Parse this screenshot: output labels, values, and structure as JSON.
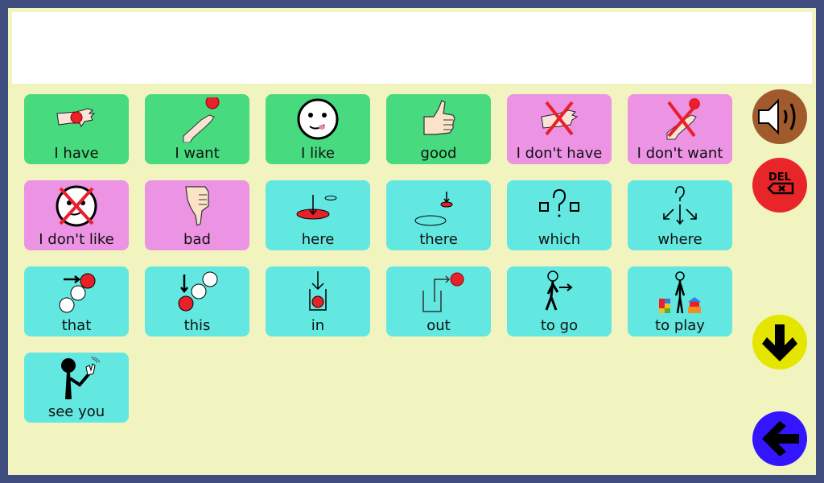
{
  "message_bar": {
    "text": ""
  },
  "tiles": [
    {
      "label": "I have",
      "category": "green",
      "icon": "hand-holding-ball-icon"
    },
    {
      "label": "I want",
      "category": "green",
      "icon": "hand-reaching-ball-icon"
    },
    {
      "label": "I like",
      "category": "green",
      "icon": "smiley-face-icon"
    },
    {
      "label": "good",
      "category": "green",
      "icon": "thumbs-up-icon"
    },
    {
      "label": "I don't have",
      "category": "pink",
      "icon": "crossed-hand-holding-icon"
    },
    {
      "label": "I don't want",
      "category": "pink",
      "icon": "crossed-hand-reaching-icon"
    },
    {
      "label": "I don't like",
      "category": "pink",
      "icon": "crossed-smiley-icon"
    },
    {
      "label": "bad",
      "category": "pink",
      "icon": "thumbs-down-icon"
    },
    {
      "label": "here",
      "category": "cyan",
      "icon": "here-icon"
    },
    {
      "label": "there",
      "category": "cyan",
      "icon": "there-icon"
    },
    {
      "label": "which",
      "category": "cyan",
      "icon": "which-icon"
    },
    {
      "label": "where",
      "category": "cyan",
      "icon": "where-icon"
    },
    {
      "label": "that",
      "category": "cyan",
      "icon": "that-icon"
    },
    {
      "label": "this",
      "category": "cyan",
      "icon": "this-icon"
    },
    {
      "label": "in",
      "category": "cyan",
      "icon": "in-icon"
    },
    {
      "label": "out",
      "category": "cyan",
      "icon": "out-icon"
    },
    {
      "label": "to go",
      "category": "cyan",
      "icon": "walking-person-icon"
    },
    {
      "label": "to play",
      "category": "cyan",
      "icon": "person-with-toys-icon"
    },
    {
      "label": "see you",
      "category": "cyan",
      "icon": "waving-person-icon"
    }
  ],
  "side_buttons": {
    "speak": {
      "icon": "speaker-icon",
      "color": "#a05a2c"
    },
    "delete": {
      "label": "DEL",
      "icon": "backspace-icon",
      "color": "#e8262a"
    },
    "scroll_down": {
      "icon": "arrow-down-icon",
      "color": "#e4e600"
    },
    "back": {
      "icon": "arrow-left-icon",
      "color": "#3316ff"
    }
  },
  "colors": {
    "frame": "#3f4d7e",
    "panel": "#f2f4c0",
    "green": "#47da7e",
    "pink": "#ec93e4",
    "cyan": "#62e8e0"
  }
}
